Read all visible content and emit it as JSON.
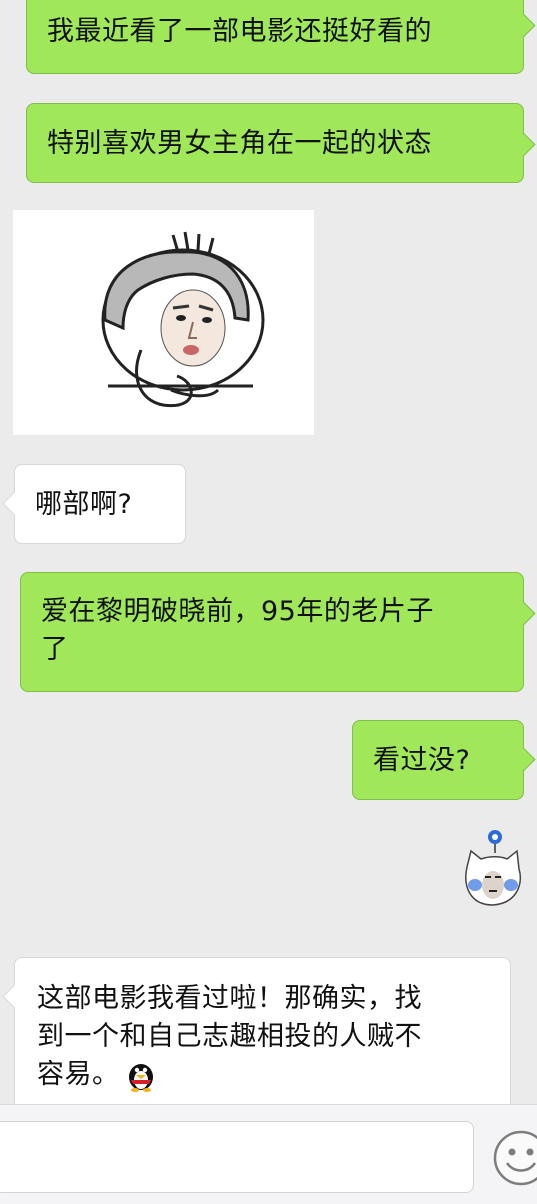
{
  "messages": [
    {
      "from": "me",
      "text": "我最近看了一部电影还挺好看的"
    },
    {
      "from": "me",
      "text": "特别喜欢男女主角在一起的状态"
    },
    {
      "from": "other",
      "type": "sticker",
      "sticker": "thinking-kid-sticker"
    },
    {
      "from": "other",
      "text": "哪部啊?"
    },
    {
      "from": "me",
      "text_line1": "爱在黎明破晓前，95年的老片子",
      "text_line2": "了"
    },
    {
      "from": "me",
      "text": "看过没?"
    },
    {
      "from": "me",
      "type": "sticker",
      "sticker": "cat-face-flower-sticker"
    },
    {
      "from": "other",
      "text_line1": "这部电影我看过啦！那确实，找",
      "text_line2": "到一个和自己志趣相投的人贼不",
      "text_line3": "容易。",
      "emoji": "penguin-emoji"
    }
  ],
  "input": {
    "value": "",
    "emoji_icon": "smiley-face-icon"
  },
  "colors": {
    "outgoing": "#a0e75a",
    "incoming": "#ffffff",
    "background": "#ebebeb"
  }
}
